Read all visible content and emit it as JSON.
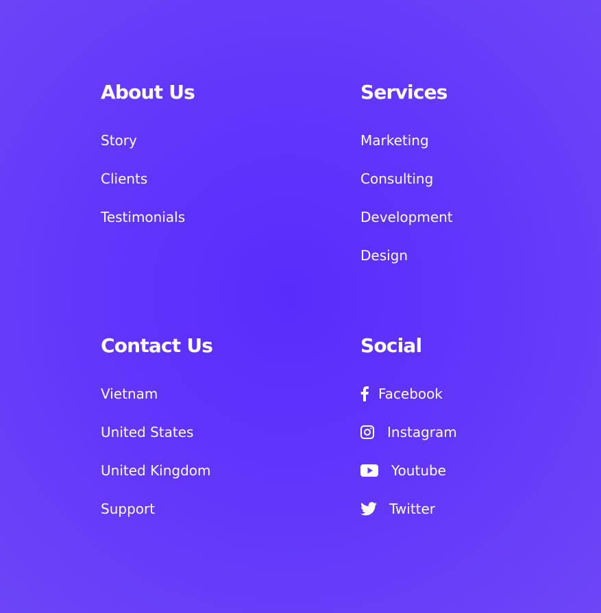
{
  "about": {
    "title": "About Us",
    "links": [
      "Story",
      "Clients",
      "Testimonials"
    ]
  },
  "services": {
    "title": "Services",
    "links": [
      "Marketing",
      "Consulting",
      "Development",
      "Design"
    ]
  },
  "contact": {
    "title": "Contact Us",
    "links": [
      "Vietnam",
      "United States",
      "United Kingdom",
      "Support"
    ]
  },
  "social": {
    "title": "Social",
    "links": [
      {
        "label": "Facebook",
        "icon": "facebook-icon"
      },
      {
        "label": "Instagram",
        "icon": "instagram-icon"
      },
      {
        "label": "Youtube",
        "icon": "youtube-icon"
      },
      {
        "label": "Twitter",
        "icon": "twitter-icon"
      }
    ]
  },
  "colors": {
    "background_center": "#5a2cfc",
    "background_edge": "#6e46f6",
    "text": "#ffffff"
  }
}
